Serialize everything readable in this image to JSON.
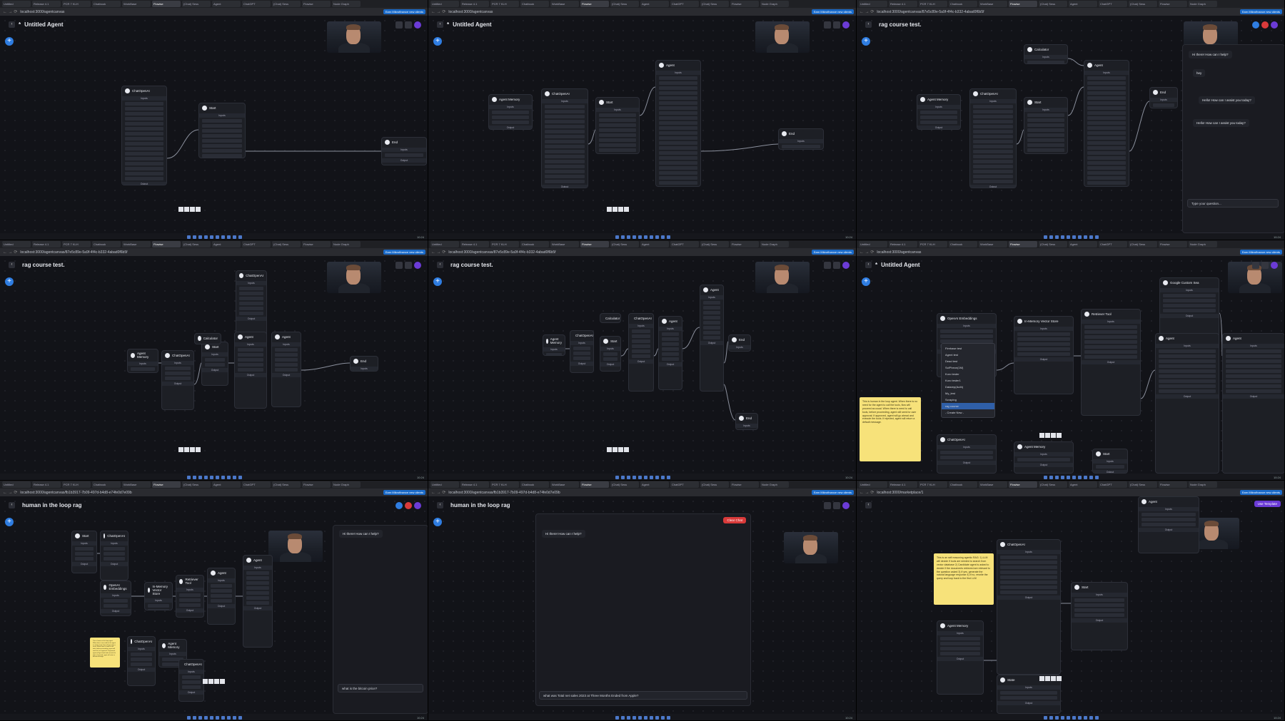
{
  "browser": {
    "tabs": [
      "Untitled",
      "Release 4.1",
      "PCR 7 KLH",
      "Chatbook",
      "WorkBase",
      "Flowise",
      "(Chat) Sess",
      "Agent",
      "ChatGPT",
      "(Chat) Sess",
      "Flowise",
      "Node Graph"
    ],
    "url_agentcanvas": "localhost:3000/agentcanvas",
    "url_rag": "localhost:3000/agentcanvas/87e5c89e-5a9f-4f4c-b332-4abad0f6b5f",
    "url_hitl": "localhost:3000/agentcanvas/fb1b3917-7b09-497d-b4d8-e74fe0d7e09b",
    "url_marketplace": "localhost:3000/marketplace/1",
    "bookmark": "Earn Mikrofinance new clients",
    "nav_glyphs": "← → ⟳"
  },
  "panels": [
    {
      "title": "Untitled Agent",
      "unsaved": "*"
    },
    {
      "title": "Untitled Agent",
      "unsaved": "*"
    },
    {
      "title": "rag course test.",
      "unsaved": ""
    },
    {
      "title": "rag course test.",
      "unsaved": ""
    },
    {
      "title": "rag course test.",
      "unsaved": ""
    },
    {
      "title": "Untitled Agent",
      "unsaved": "*"
    },
    {
      "title": "human in the loop rag",
      "unsaved": ""
    },
    {
      "title": "human in the loop rag",
      "unsaved": ""
    },
    {
      "title": "",
      "unsaved": ""
    }
  ],
  "nodes": {
    "chat_openai": "ChatOpenAI",
    "start": "Start",
    "end": "End",
    "agent": "Agent",
    "agent_memory": "Agent Memory",
    "calculator": "Calculator",
    "openai_embeddings": "OpenAI Embeddings",
    "in_memory_vector_store": "In-Memory Vector Store",
    "retriever_tool": "Retriever Tool",
    "google_custom_search": "Google Custom Sea",
    "state": "State",
    "inputs": "Inputs",
    "output": "Output",
    "connect_credential": "Connect Credential",
    "model_name": "Model Name",
    "temperature": "Temperature",
    "additional_params": "Additional Parameters",
    "system_prompt": "System Prompt",
    "tools": "Tools",
    "retriever_name": "Retriever Name",
    "return_source_docs": "Return Source Documents",
    "memory_retriever": "Memory Retriever"
  },
  "credential_dropdown": {
    "options": [
      "Firebase test",
      "Agent test",
      "Dead test",
      "SciPheon(1M)",
      "Kuro tester",
      "Kuro tester1",
      "Datarep(Auth)",
      "My_test",
      "Scraping",
      "rag course",
      "- Create New -"
    ],
    "selected_index": 9
  },
  "chat": {
    "greeting": "Hi there! How can I help?",
    "user_hey": "hey",
    "reply_1": "Hello! How can I assist you today?",
    "reply_2": "Hello! How can I assist you today?",
    "input_placeholder": "Type your question...",
    "hitl_user_question": "what is the bitcoin price?",
    "hitl_long_question": "what was Total net sales 2023 at Three Months Ended from Apple?",
    "clear_chat": "Clear Chat",
    "send_glyph": "➤"
  },
  "sticky_notes": {
    "human_loop": "This is human in the loop agent. When there is no need for the agent to call the tools, flow will proceed as usual. When there is need to call tools, before proceeding, agent will seek for user approval. If approved, agent will go ahead and execute the tools. If rejected, agent will return a default message.",
    "ask_pdf": "This is an self reasoning agentic RAG: 1) LLM will decide if tools are needed to search from vector database 2) Candidate agent is asked to decide if the documents retrieved are relevant to the question asked 3) If yes, generate the natural language response 4) If no, rewrite the query and loop back to the first LLM"
  },
  "marketplace": {
    "use_template": "Use Template"
  },
  "taskbar": {
    "time": "10:24",
    "date": "27/01/2025"
  }
}
